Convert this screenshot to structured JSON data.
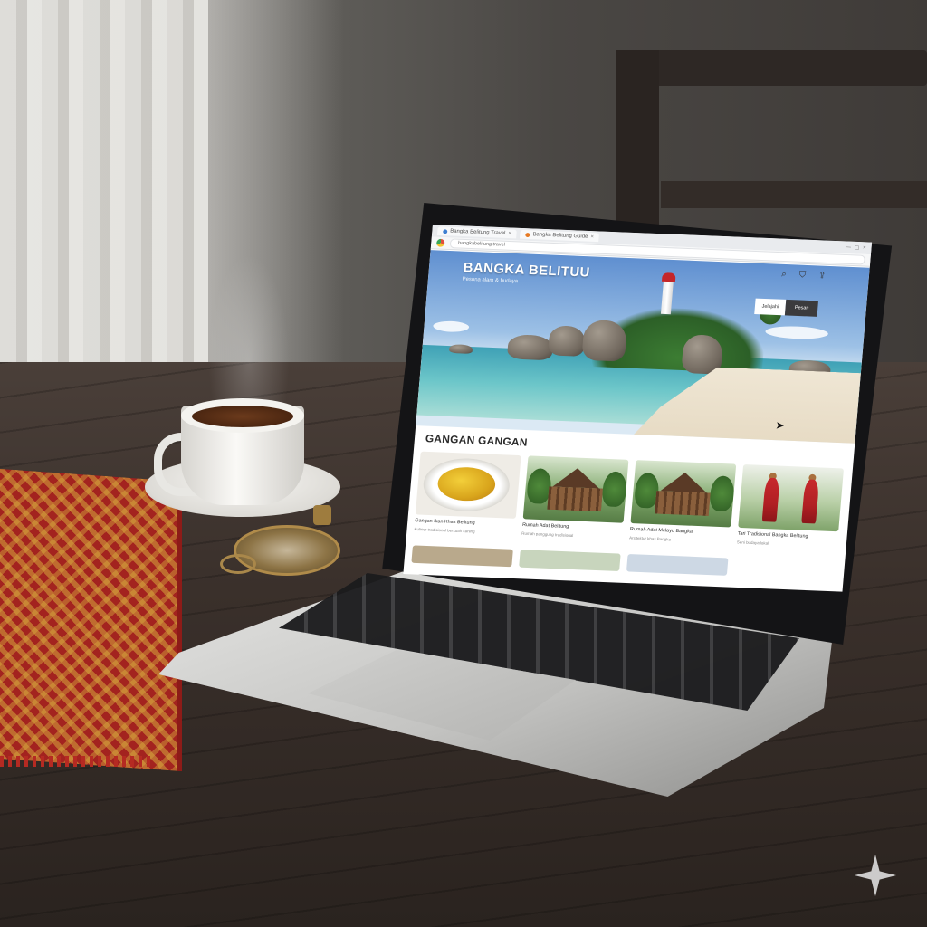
{
  "browser": {
    "tabs": [
      {
        "label": "Bangka Belitung Travel",
        "icon": "globe-icon"
      },
      {
        "label": "Bangka Belitung Guide",
        "icon": "orange-site-icon"
      }
    ],
    "controls": [
      "—",
      "☐",
      "×"
    ],
    "url": "bangkabelitung.travel"
  },
  "hero": {
    "title": "BANGKA BELITUU",
    "subtitle": "Pesona alam & budaya",
    "nav_icons": [
      "search-icon",
      "bookmark-icon",
      "share-icon"
    ],
    "button_a": "Jelajahi",
    "button_b": "Pesan"
  },
  "section": {
    "title": "GANGAN GANGAN"
  },
  "cards": [
    {
      "title": "Gangan Ikan Khas Belitung",
      "subtitle": "Kuliner tradisional berkuah kuning",
      "image": "food"
    },
    {
      "title": "Rumah Adat Belitung",
      "subtitle": "Rumah panggung tradisional",
      "image": "house"
    },
    {
      "title": "Rumah Adat Melayu Bangka",
      "subtitle": "Arsitektur khas Bangka",
      "image": "house"
    },
    {
      "title": "Tari Tradisional Bangka Belitung",
      "subtitle": "Seni budaya lokal",
      "image": "dance"
    }
  ],
  "colors": {
    "accent_dark": "#3b3b3d",
    "sky": "#5f8fd0",
    "sea": "#3fa1b6",
    "dancer_red": "#c7292d"
  }
}
